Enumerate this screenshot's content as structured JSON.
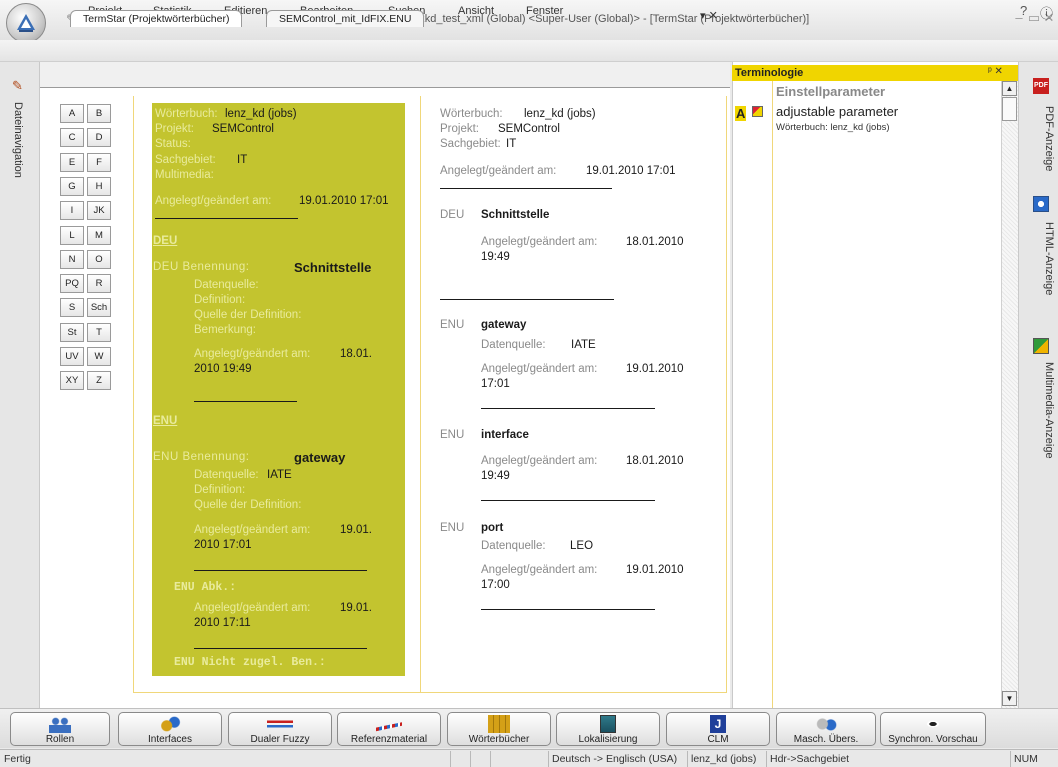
{
  "titlebar": {
    "title": "Transit NXT SP 2 - lenzkd_test_xml (Global) <Super-User (Global)> - [TermStar (Projektwörterbücher)]",
    "minimize": "–",
    "maximize": "▭",
    "close": "✕"
  },
  "menu": {
    "items": [
      "Projekt",
      "Statistik",
      "Editieren",
      "Bearbeiten",
      "Suchen",
      "Ansicht",
      "Fenster"
    ]
  },
  "leftnav": {
    "label": "Dateinavigation"
  },
  "tabs": [
    {
      "label": "TermStar (Projektwörterbücher)"
    },
    {
      "label": "SEMControl_mit_IdFIX.ENU"
    }
  ],
  "tab_controls": "▾ ✕",
  "alphabet": [
    "A",
    "B",
    "C",
    "D",
    "E",
    "F",
    "G",
    "H",
    "I",
    "JK",
    "L",
    "M",
    "N",
    "O",
    "PQ",
    "R",
    "S",
    "Sch",
    "St",
    "T",
    "UV",
    "W",
    "XY",
    "Z"
  ],
  "entry_left": {
    "dict_label": "Wörterbuch:",
    "dict_value": "lenz_kd (jobs)",
    "project_label": "Projekt:",
    "project_value": "SEMControl",
    "status_label": "Status:",
    "subject_label": "Sachgebiet:",
    "subject_value": "IT",
    "multimedia_label": "Multimedia:",
    "changed_label": "Angelegt/geändert am:",
    "changed_value": "19.01.2010 17:01",
    "deu_heading": "DEU",
    "deu_term_prefix": "DEU Benennung:",
    "deu_term": "Schnittstelle",
    "deu_datasource_label": "Datenquelle:",
    "deu_definition_label": "Definition:",
    "deu_defsource_label": "Quelle der Definition:",
    "deu_remark_label": "Bemerkung:",
    "deu_changed_label": "Angelegt/geändert am:",
    "deu_changed_value_1": "18.01.",
    "deu_changed_value_2": "2010 19:49",
    "enu_heading": "ENU",
    "enu_term_prefix": "ENU Benennung:",
    "enu_term": "gateway",
    "enu_datasource_label": "Datenquelle:",
    "enu_datasource_value": "IATE",
    "enu_definition_label": "Definition:",
    "enu_defsource_label": "Quelle der Definition:",
    "enu_changed_label": "Angelegt/geändert am:",
    "enu_changed_value_1": "19.01.",
    "enu_changed_value_2": "2010 17:01",
    "abk_label": "ENU Abk.:",
    "abk_changed_label": "Angelegt/geändert am:",
    "abk_changed_value_1": "19.01.",
    "abk_changed_value_2": "2010 17:11",
    "nzb_label": "ENU Nicht zugel. Ben.:"
  },
  "entry_right": {
    "dict_label": "Wörterbuch:",
    "dict_value": "lenz_kd (jobs)",
    "project_label": "Projekt:",
    "project_value": "SEMControl",
    "subject_label": "Sachgebiet:",
    "subject_value": "IT",
    "changed_label": "Angelegt/geändert am:",
    "changed_value": "19.01.2010 17:01",
    "terms": [
      {
        "lang": "DEU",
        "term": "Schnittstelle",
        "changed_label": "Angelegt/geändert am:",
        "changed_1": "18.01.2010",
        "changed_2": "19:49"
      },
      {
        "lang": "ENU",
        "term": "gateway",
        "source_label": "Datenquelle:",
        "source": "IATE",
        "changed_label": "Angelegt/geändert am:",
        "changed_1": "19.01.2010",
        "changed_2": "17:01"
      },
      {
        "lang": "ENU",
        "term": "interface",
        "changed_label": "Angelegt/geändert am:",
        "changed_1": "18.01.2010",
        "changed_2": "19:49"
      },
      {
        "lang": "ENU",
        "term": "port",
        "source_label": "Datenquelle:",
        "source": "LEO",
        "changed_label": "Angelegt/geändert am:",
        "changed_1": "19.01.2010",
        "changed_2": "17:00"
      }
    ]
  },
  "terminology": {
    "header": "Terminologie",
    "header_controls": "ᵖ ✕",
    "source_term": "Einstellparameter",
    "marker": "A",
    "target_term": "adjustable parameter",
    "dict_line": "Wörterbuch: lenz_kd (jobs)"
  },
  "rightbar": {
    "tabs": [
      "PDF-Anzeige",
      "HTML-Anzeige",
      "Multimedia-Anzeige"
    ]
  },
  "toolbar": {
    "buttons": [
      "Rollen",
      "Interfaces",
      "Dualer Fuzzy",
      "Referenzmaterial",
      "Wörterbücher",
      "Lokalisierung",
      "CLM",
      "Masch. Übers.",
      "Synchron. Vorschau"
    ]
  },
  "status": {
    "left": "Fertig",
    "languages": "Deutsch -> Englisch (USA)",
    "dict": "lenz_kd (jobs)",
    "field": "Hdr->Sachgebiet",
    "num": "NUM"
  },
  "colors": {
    "accent_yellow": "#c3c42f",
    "header_yellow": "#f0d500"
  }
}
